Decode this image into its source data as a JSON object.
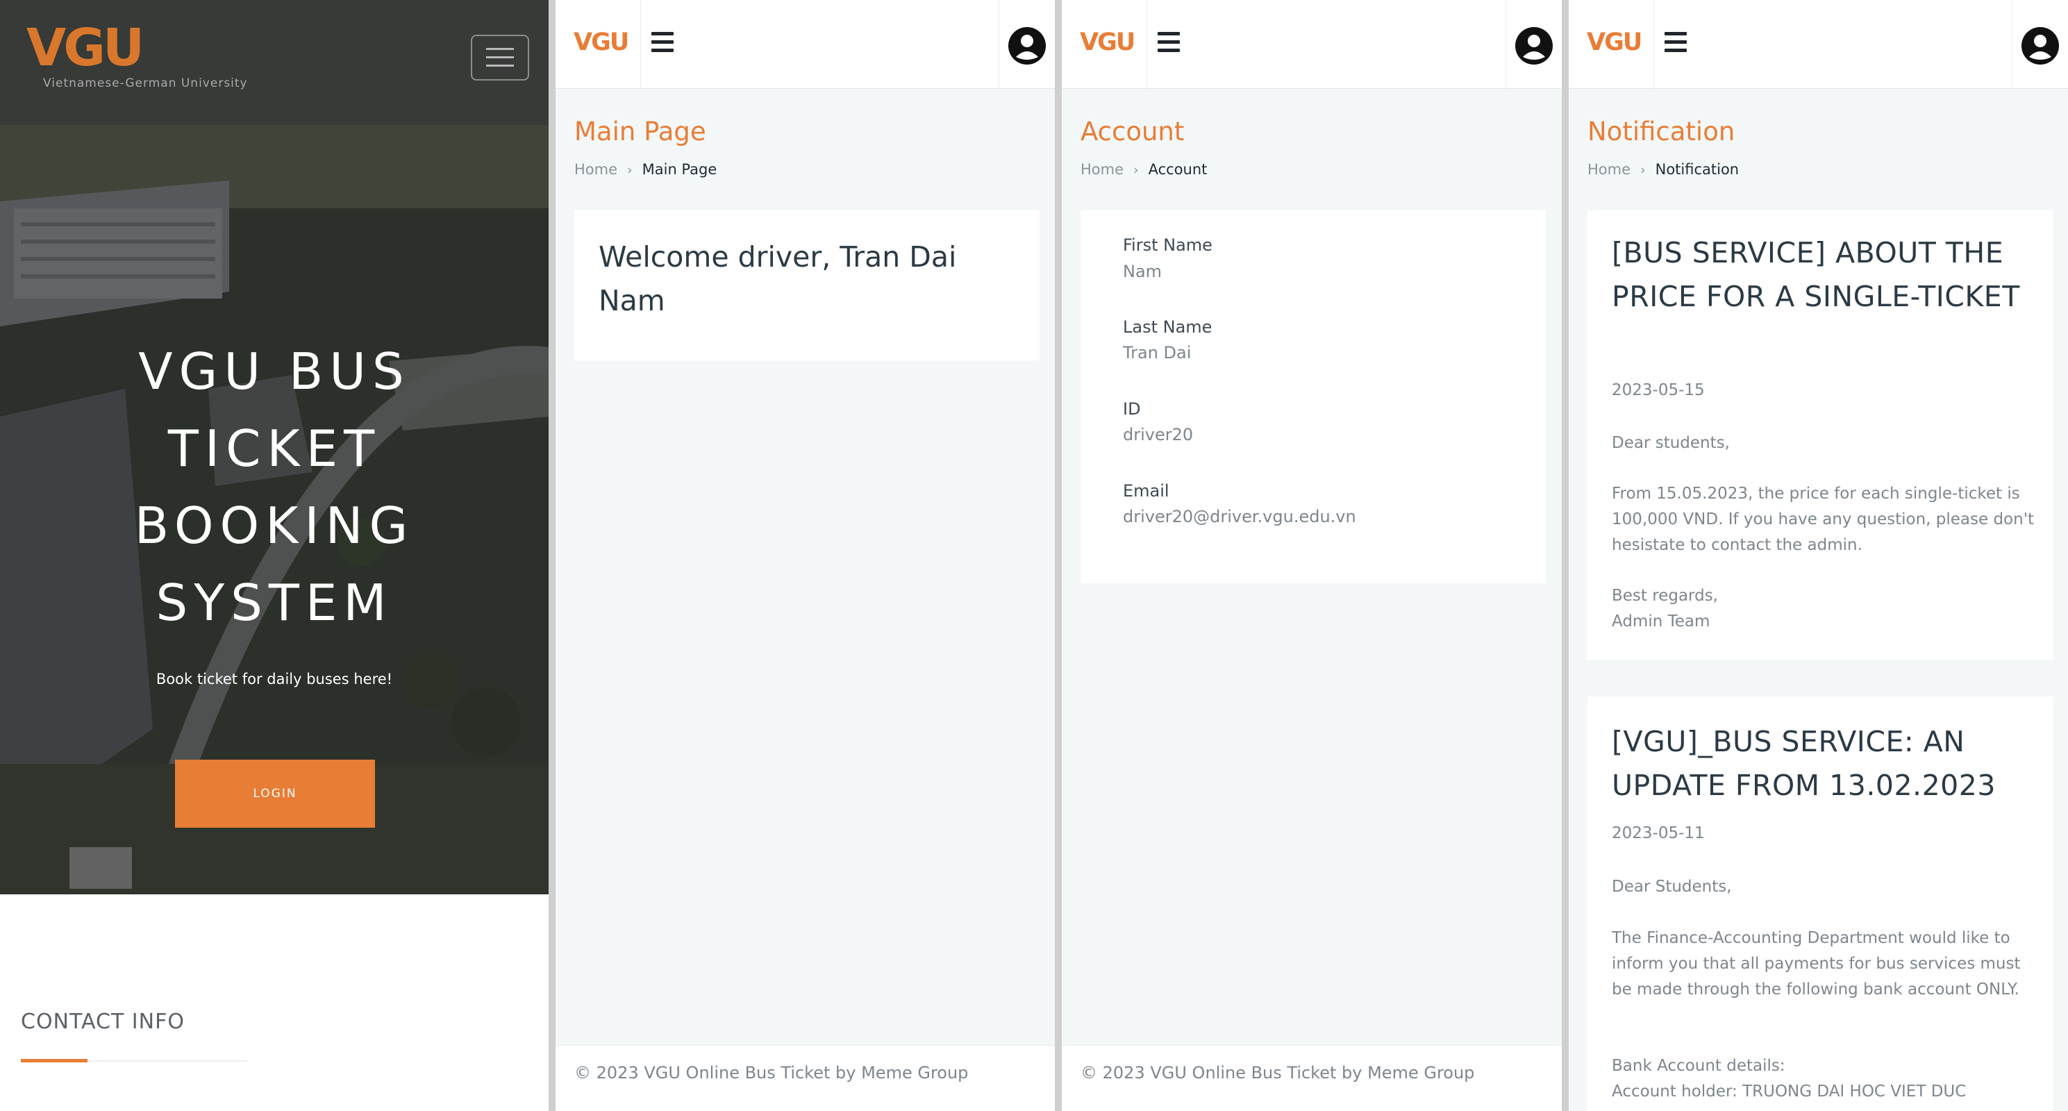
{
  "landing": {
    "logo_text": "VGU",
    "logo_subtitle": "Vietnamese-German University",
    "title_lines": [
      "VGU BUS",
      "TICKET",
      "BOOKING",
      "SYSTEM"
    ],
    "subtitle": "Book ticket for daily buses here!",
    "login_label": "LOGIN",
    "contact_heading": "CONTACT INFO"
  },
  "app": {
    "logo_text": "VGU",
    "footer": "© 2023 VGU Online Bus Ticket by Meme Group",
    "breadcrumb_home": "Home"
  },
  "main_page": {
    "title": "Main Page",
    "breadcrumb_current": "Main Page",
    "welcome": "Welcome driver, Tran Dai Nam"
  },
  "account": {
    "title": "Account",
    "breadcrumb_current": "Account",
    "fields": [
      {
        "label": "First Name",
        "value": "Nam"
      },
      {
        "label": "Last Name",
        "value": "Tran Dai"
      },
      {
        "label": "ID",
        "value": "driver20"
      },
      {
        "label": "Email",
        "value": "driver20@driver.vgu.edu.vn"
      }
    ]
  },
  "notification": {
    "title": "Notification",
    "breadcrumb_current": "Notification",
    "items": [
      {
        "title": "[BUS SERVICE] ABOUT THE PRICE FOR A SINGLE-TICKET",
        "date": "2023-05-15",
        "greeting": "Dear students,",
        "body": "From 15.05.2023, the price for each single-ticket is 100,000 VND. If you have any question, please don't hesistate to contact the admin.",
        "closing": "Best regards,",
        "signature": "Admin Team"
      },
      {
        "title": "[VGU]_BUS SERVICE: AN UPDATE FROM 13.02.2023",
        "date": "2023-05-11",
        "greeting": "Dear Students,",
        "body": "The Finance-Accounting Department would like to inform you that all payments for bus services must be made through the following bank account ONLY.",
        "bank_heading": "Bank Account details:",
        "bank_holder": "Account holder: TRUONG DAI HOC VIET DUC"
      }
    ]
  },
  "colors": {
    "accent": "#e87d35",
    "heading_text": "#2b3a44",
    "muted_text": "#7d868c",
    "page_bg": "#f4f7f8"
  }
}
